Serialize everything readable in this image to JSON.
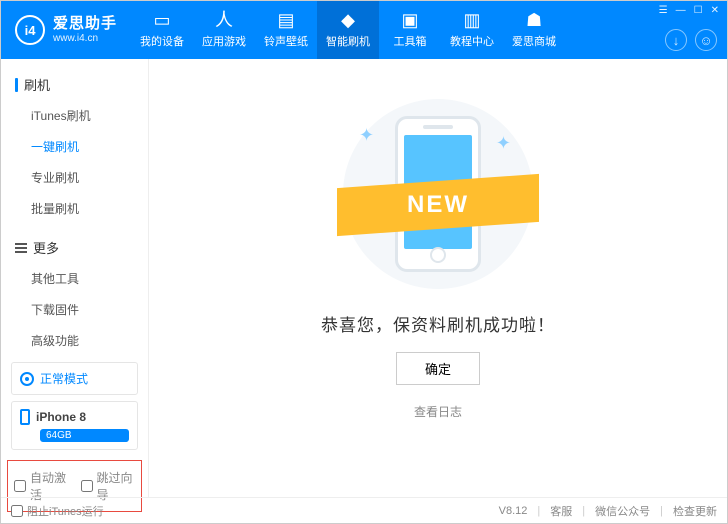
{
  "brand": {
    "initials": "i4",
    "name": "爱思助手",
    "url": "www.i4.cn"
  },
  "nav": {
    "items": [
      {
        "label": "我的设备"
      },
      {
        "label": "应用游戏"
      },
      {
        "label": "铃声壁纸"
      },
      {
        "label": "智能刷机"
      },
      {
        "label": "工具箱"
      },
      {
        "label": "教程中心"
      },
      {
        "label": "爱思商城"
      }
    ]
  },
  "sidebar": {
    "group1": {
      "title": "刷机",
      "items": [
        "iTunes刷机",
        "一键刷机",
        "专业刷机",
        "批量刷机"
      ]
    },
    "group2": {
      "title": "更多",
      "items": [
        "其他工具",
        "下载固件",
        "高级功能"
      ]
    },
    "mode": "正常模式",
    "device": {
      "name": "iPhone 8",
      "storage": "64GB"
    },
    "checkboxes": {
      "auto_activate": "自动激活",
      "skip_guide": "跳过向导"
    }
  },
  "main": {
    "ribbon": "NEW",
    "success": "恭喜您，保资料刷机成功啦！",
    "ok": "确定",
    "logs": "查看日志"
  },
  "footer": {
    "block_itunes": "阻止iTunes运行",
    "version": "V8.12",
    "service": "客服",
    "wechat": "微信公众号",
    "update": "检查更新"
  }
}
